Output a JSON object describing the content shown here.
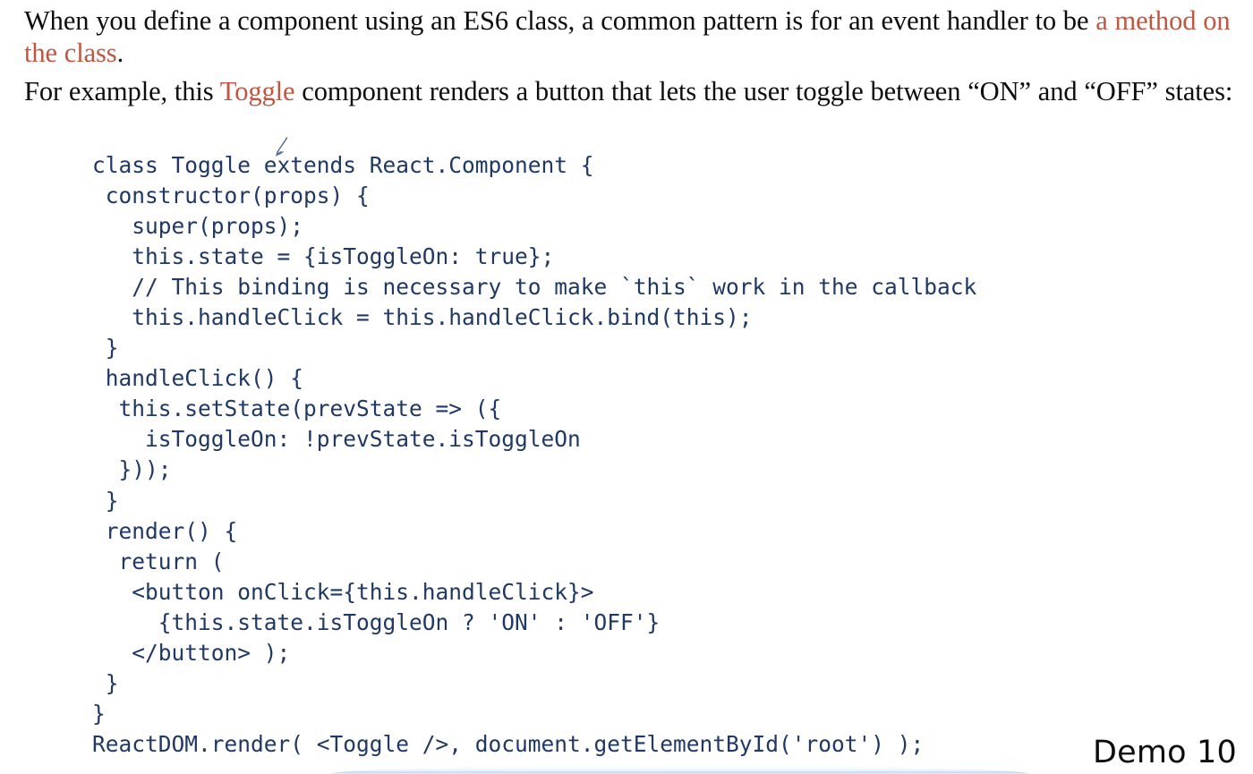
{
  "slide": {
    "background_color": "#ffffff",
    "text_color": "#0d0d0d",
    "accent_color": "#c1553f",
    "code_color": "#1f3864"
  },
  "prose": {
    "paragraph1": {
      "segment1": "When you define a component using an ES6 class, a common pattern is for an event handler to be ",
      "accent": "a method on the class",
      "segment2": "."
    },
    "paragraph2": {
      "segment1": "For example, this ",
      "accent": "Toggle",
      "segment2": " component renders a button that lets the user toggle between “ON” and “OFF” states:"
    }
  },
  "code": {
    "language": "jsx",
    "lines": [
      "class Toggle extends React.Component {",
      " constructor(props) {",
      "   super(props);",
      "   this.state = {isToggleOn: true};",
      "   // This binding is necessary to make `this` work in the callback",
      "   this.handleClick = this.handleClick.bind(this);",
      " }",
      " handleClick() {",
      "  this.setState(prevState => ({",
      "    isToggleOn: !prevState.isToggleOn",
      "  }));",
      " }",
      " render() {",
      "  return (",
      "   <button onClick={this.handleClick}>",
      "     {this.state.isToggleOn ? 'ON' : 'OFF'}",
      "   </button> );",
      " }",
      "}",
      "ReactDOM.render( <Toggle />, document.getElementById('root') );"
    ]
  },
  "footer": {
    "demo_label": "Demo 10"
  },
  "artifacts": {
    "pen_cursor": "pen-cursor-icon"
  }
}
